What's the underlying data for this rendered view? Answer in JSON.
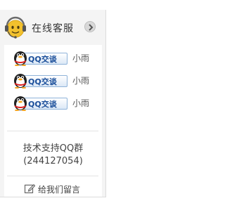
{
  "header": {
    "title": "在线客服",
    "avatar_icon": "headset-agent-icon",
    "collapse_icon": "chevron-right-icon"
  },
  "agents": [
    {
      "button_label": "QQ交谈",
      "name": "小雨",
      "icon": "qq-penguin-icon"
    },
    {
      "button_label": "QQ交谈",
      "name": "小雨",
      "icon": "qq-penguin-icon"
    },
    {
      "button_label": "QQ交谈",
      "name": "小雨",
      "icon": "qq-penguin-icon"
    }
  ],
  "support": {
    "line1": "技术支持QQ群",
    "line2": "(244127054)"
  },
  "message": {
    "label": "给我们留言",
    "icon": "edit-icon"
  },
  "colors": {
    "avatar_yellow": "#f2c12e",
    "qq_blue": "#1a4e9a",
    "panel_bg": "#f4f4f4"
  }
}
